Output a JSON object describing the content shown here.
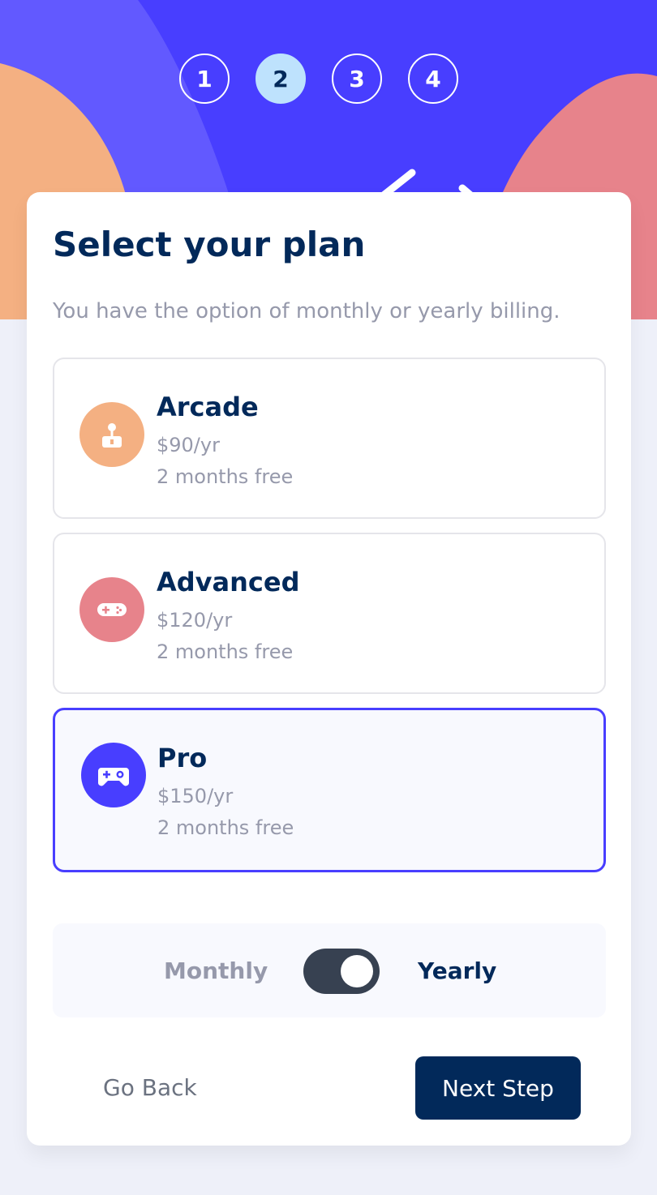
{
  "steps": [
    "1",
    "2",
    "3",
    "4"
  ],
  "active_step": "2",
  "title": "Select your plan",
  "subtitle": "You have the option of monthly or yearly billing.",
  "plans": [
    {
      "name": "Arcade",
      "price": "$90/yr",
      "bonus": "2 months free",
      "icon": "joystick-icon",
      "color": "#f4b082",
      "selected": false
    },
    {
      "name": "Advanced",
      "price": "$120/yr",
      "bonus": "2 months free",
      "icon": "gamepad-icon",
      "color": "#e7838b",
      "selected": false
    },
    {
      "name": "Pro",
      "price": "$150/yr",
      "bonus": "2 months free",
      "icon": "controller-icon",
      "color": "#483eff",
      "selected": true
    }
  ],
  "billing": {
    "monthly_label": "Monthly",
    "yearly_label": "Yearly",
    "selected": "Yearly"
  },
  "buttons": {
    "back": "Go Back",
    "next": "Next Step"
  },
  "colors": {
    "primary": "#483eff",
    "navy": "#02295a",
    "muted": "#9699ab",
    "active_step": "#bee2fd"
  }
}
